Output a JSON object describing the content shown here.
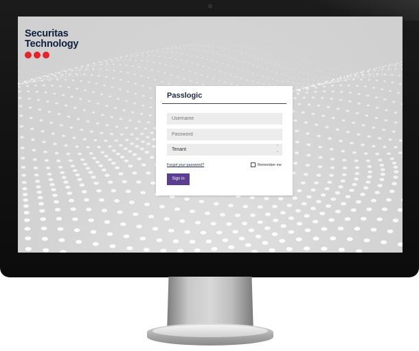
{
  "brand": {
    "line1": "Securitas",
    "line2": "Technology",
    "accent_color": "#e3242b",
    "text_color": "#0d1f3c"
  },
  "login": {
    "title": "Passlogic",
    "username_placeholder": "Username",
    "password_placeholder": "Password",
    "tenant_value": "Tenant",
    "forgot_link": "Forgot your password?",
    "remember_label": "Remember me",
    "signin_label": "Sign in",
    "button_color": "#5b3e91"
  }
}
